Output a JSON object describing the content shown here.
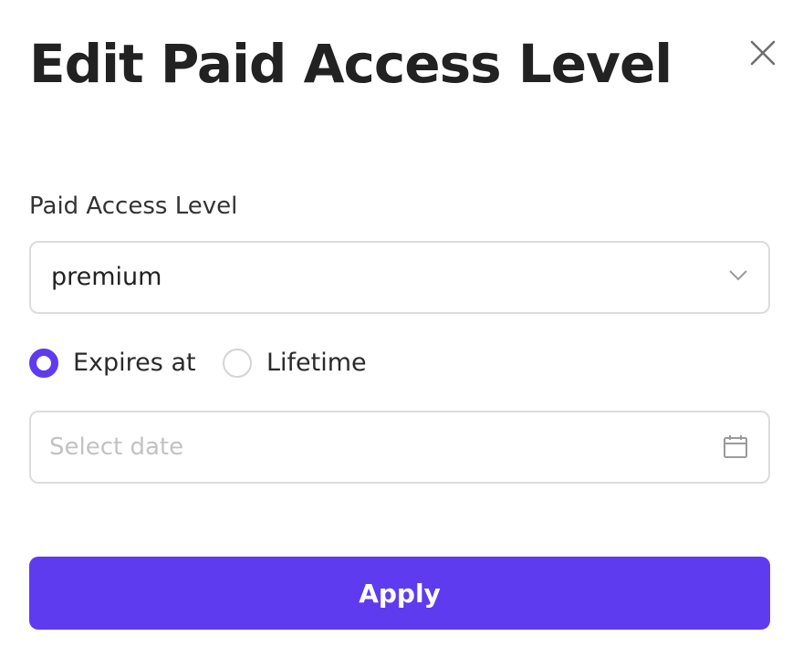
{
  "modal": {
    "title": "Edit Paid Access Level"
  },
  "form": {
    "access_level_label": "Paid Access Level",
    "access_level_value": "premium",
    "expiry": {
      "options": [
        {
          "label": "Expires at",
          "selected": true
        },
        {
          "label": "Lifetime",
          "selected": false
        }
      ]
    },
    "date_placeholder": "Select date",
    "date_value": ""
  },
  "actions": {
    "apply_label": "Apply"
  },
  "icons": {
    "close": "close-icon",
    "chevron": "chevron-down-icon",
    "calendar": "calendar-icon"
  },
  "colors": {
    "accent": "#5f3bf0",
    "border": "#dcdcdc",
    "text": "#222222",
    "placeholder": "#c2c2c2"
  }
}
